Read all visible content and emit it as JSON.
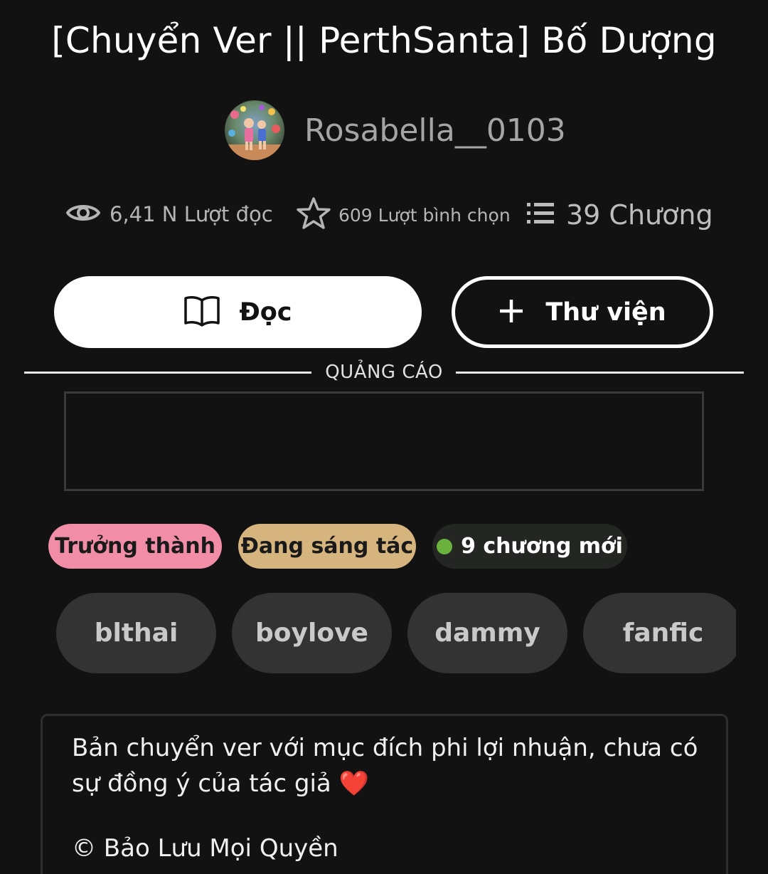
{
  "story": {
    "title": "[Chuyển Ver || PerthSanta] Bố Dượng",
    "author": "Rosabella__0103"
  },
  "stats": {
    "reads": "6,41 N Lượt đọc",
    "votes": "609 Lượt bình chọn",
    "chapters": "39 Chương"
  },
  "actions": {
    "read_label": "Đọc",
    "library_label": "Thư viện"
  },
  "ad": {
    "label": "QUẢNG CÁO"
  },
  "badges": {
    "mature": "Trưởng thành",
    "ongoing": "Đang sáng tác",
    "new_chapters": "9 chương mới"
  },
  "tags": [
    "blthai",
    "boylove",
    "dammy",
    "fanfic"
  ],
  "description": {
    "text": "Bản chuyển ver với mục đích phi lợi nhuận, chưa có sự đồng ý của tác giả",
    "emoji": "❤️",
    "copyright": "© Bảo Lưu Mọi Quyền"
  },
  "colors": {
    "background": "#121212",
    "mature_badge": "#f28da8",
    "ongoing_badge": "#d6b47d",
    "new_dot": "#6ab23d",
    "tag_bg": "#333333"
  },
  "icons": {
    "reads": "eye-icon",
    "votes": "star-icon",
    "chapters": "list-icon",
    "read": "open-book-icon",
    "library": "plus-icon"
  }
}
